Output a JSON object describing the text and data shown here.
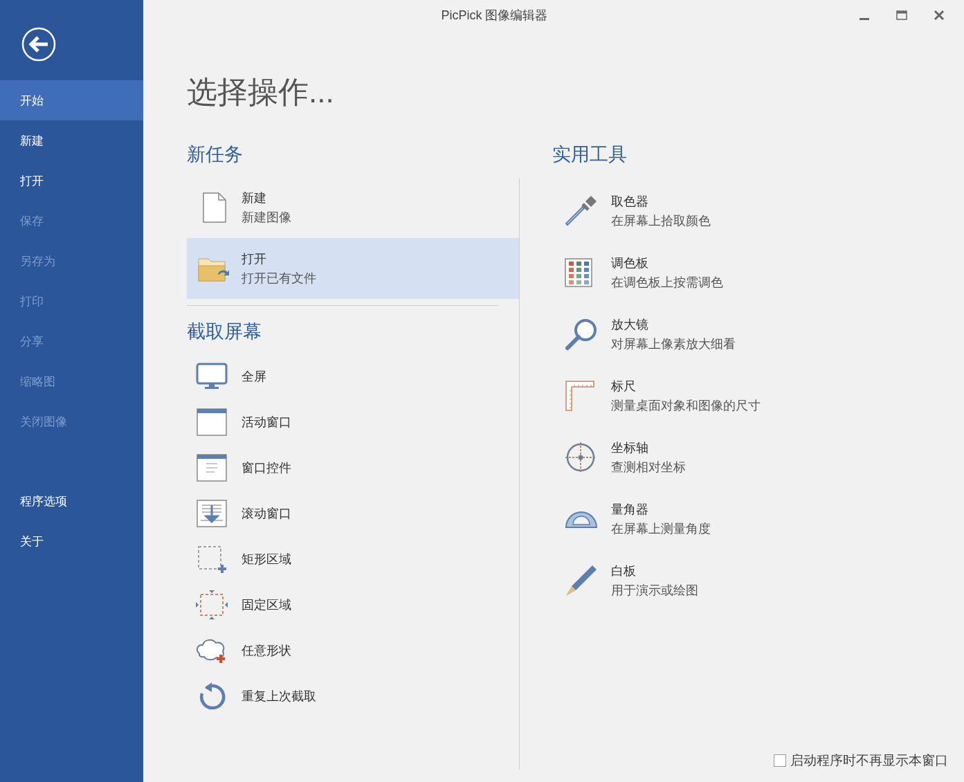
{
  "window": {
    "title": "PicPick 图像编辑器"
  },
  "sidebar": {
    "items": [
      {
        "label": "开始",
        "selected": true,
        "disabled": false
      },
      {
        "label": "新建",
        "selected": false,
        "disabled": false
      },
      {
        "label": "打开",
        "selected": false,
        "disabled": false
      },
      {
        "label": "保存",
        "selected": false,
        "disabled": true
      },
      {
        "label": "另存为",
        "selected": false,
        "disabled": true
      },
      {
        "label": "打印",
        "selected": false,
        "disabled": true
      },
      {
        "label": "分享",
        "selected": false,
        "disabled": true
      },
      {
        "label": "缩略图",
        "selected": false,
        "disabled": true
      },
      {
        "label": "关闭图像",
        "selected": false,
        "disabled": true
      }
    ],
    "footer_items": [
      {
        "label": "程序选项",
        "selected": false,
        "disabled": false
      },
      {
        "label": "关于",
        "selected": false,
        "disabled": false
      }
    ]
  },
  "heading": "选择操作...",
  "new_task": {
    "title": "新任务",
    "items": [
      {
        "title": "新建",
        "subtitle": "新建图像",
        "selected": false
      },
      {
        "title": "打开",
        "subtitle": "打开已有文件",
        "selected": true
      }
    ]
  },
  "capture": {
    "title": "截取屏幕",
    "items": [
      {
        "label": "全屏"
      },
      {
        "label": "活动窗口"
      },
      {
        "label": "窗口控件"
      },
      {
        "label": "滚动窗口"
      },
      {
        "label": "矩形区域"
      },
      {
        "label": "固定区域"
      },
      {
        "label": "任意形状"
      },
      {
        "label": "重复上次截取"
      }
    ]
  },
  "tools": {
    "title": "实用工具",
    "items": [
      {
        "title": "取色器",
        "subtitle": "在屏幕上拾取颜色"
      },
      {
        "title": "调色板",
        "subtitle": "在调色板上按需调色"
      },
      {
        "title": "放大镜",
        "subtitle": "对屏幕上像素放大细看"
      },
      {
        "title": "标尺",
        "subtitle": "测量桌面对象和图像的尺寸"
      },
      {
        "title": "坐标轴",
        "subtitle": "查测相对坐标"
      },
      {
        "title": "量角器",
        "subtitle": "在屏幕上测量角度"
      },
      {
        "title": "白板",
        "subtitle": "用于演示或绘图"
      }
    ]
  },
  "startup_checkbox": {
    "label": "启动程序时不再显示本窗口",
    "checked": false
  }
}
